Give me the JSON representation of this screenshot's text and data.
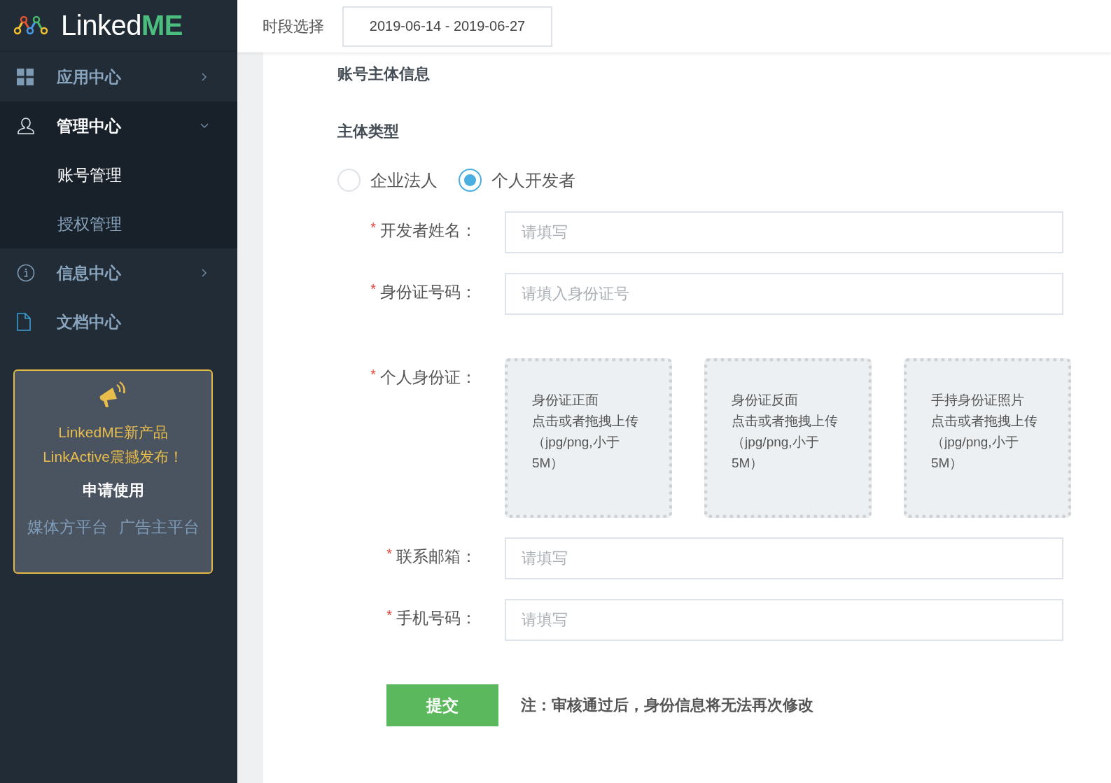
{
  "logo": {
    "text_main": "Linked",
    "text_accent": "ME"
  },
  "sidebar": {
    "items": [
      {
        "label": "应用中心",
        "kind": "group",
        "expanded": false
      },
      {
        "label": "管理中心",
        "kind": "group",
        "expanded": true,
        "children": [
          {
            "label": "账号管理",
            "selected": true
          },
          {
            "label": "授权管理",
            "selected": false
          }
        ]
      },
      {
        "label": "信息中心",
        "kind": "group",
        "expanded": false
      },
      {
        "label": "文档中心",
        "kind": "link",
        "expanded": false
      }
    ]
  },
  "promo": {
    "line_1": "LinkedME新产品",
    "line_2": "LinkActive震撼发布！",
    "apply": "申请使用",
    "links": [
      "媒体方平台",
      "广告主平台"
    ]
  },
  "topbar": {
    "label": "时段选择",
    "date_range": "2019-06-14 - 2019-06-27"
  },
  "form": {
    "section_title": "账号主体信息",
    "type_label": "主体类型",
    "radios": [
      {
        "label": "企业法人",
        "selected": false
      },
      {
        "label": "个人开发者",
        "selected": true
      }
    ],
    "fields": [
      {
        "kind": "text",
        "label": "开发者姓名：",
        "required_mark": "*",
        "placeholder": "请填写"
      },
      {
        "kind": "text",
        "label": "身份证号码：",
        "required_mark": "*",
        "placeholder": "请填入身份证号"
      },
      {
        "kind": "upload",
        "label": "个人身份证：",
        "required_mark": "*",
        "uploads": [
          {
            "title": "身份证正面",
            "hint": "点击或者拖拽上传（jpg/png,小于5M）"
          },
          {
            "title": "身份证反面",
            "hint": "点击或者拖拽上传（jpg/png,小于5M）"
          },
          {
            "title": "手持身份证照片",
            "hint": "点击或者拖拽上传（jpg/png,小于5M）"
          }
        ]
      },
      {
        "kind": "text",
        "label": "联系邮箱：",
        "required_mark": "*",
        "placeholder": "请填写"
      },
      {
        "kind": "text",
        "label": "手机号码：",
        "required_mark": "*",
        "placeholder": "请填写"
      }
    ],
    "submit": "提交",
    "note": "注：审核通过后，身份信息将无法再次修改"
  }
}
